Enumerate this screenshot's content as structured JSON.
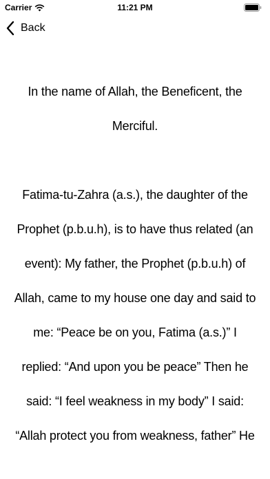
{
  "status_bar": {
    "carrier": "Carrier",
    "time": "11:21 PM",
    "icons": [
      "wifi-icon",
      "battery-icon"
    ]
  },
  "nav": {
    "back_label": "Back",
    "back_icon": "chevron-left-icon"
  },
  "content": {
    "paragraphs": [
      "In the name of Allah, the Beneficent, the Merciful.",
      "Fatima-tu-Zahra (a.s.), the daughter of the Prophet (p.b.u.h), is to have thus related (an event): My father, the Prophet (p.b.u.h) of Allah, came to my house one day and said to me: “Peace be on you, Fatima (a.s.)” I replied: “And upon you be peace” Then he said: “I feel weakness in my body” I said: “Allah protect you from weakness, father” He"
    ]
  }
}
